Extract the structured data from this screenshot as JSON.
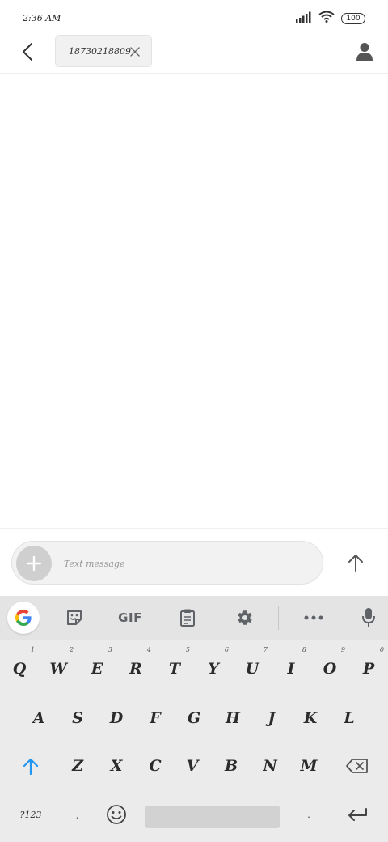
{
  "status_bar": {
    "time": "2:36 AM",
    "battery": "100",
    "icons": [
      "signal-icon",
      "wifi-icon",
      "battery-icon"
    ]
  },
  "header": {
    "back_icon": "back-arrow-icon",
    "recipient": "18730218809",
    "chip_close_icon": "close-icon",
    "contact_icon": "person-icon"
  },
  "compose": {
    "attach_icon": "plus-icon",
    "placeholder": "Text message",
    "send_icon": "arrow-up-icon"
  },
  "keyboard": {
    "toolbar": {
      "google": "google-icon",
      "sticker": "sticker-icon",
      "gif_label": "GIF",
      "clipboard": "clipboard-icon",
      "settings": "gear-icon",
      "more": "more-icon",
      "mic": "mic-icon"
    },
    "row1": [
      {
        "label": "Q",
        "hint": "1"
      },
      {
        "label": "W",
        "hint": "2"
      },
      {
        "label": "E",
        "hint": "3"
      },
      {
        "label": "R",
        "hint": "4"
      },
      {
        "label": "T",
        "hint": "5"
      },
      {
        "label": "Y",
        "hint": "6"
      },
      {
        "label": "U",
        "hint": "7"
      },
      {
        "label": "I",
        "hint": "8"
      },
      {
        "label": "O",
        "hint": "9"
      },
      {
        "label": "P",
        "hint": "0"
      }
    ],
    "row2": [
      "A",
      "S",
      "D",
      "F",
      "G",
      "H",
      "J",
      "K",
      "L"
    ],
    "row3": [
      "Z",
      "X",
      "C",
      "V",
      "B",
      "N",
      "M"
    ],
    "row4": {
      "symbols": "?123",
      "comma": ",",
      "period": "."
    },
    "accent_color": "#2196f3"
  }
}
